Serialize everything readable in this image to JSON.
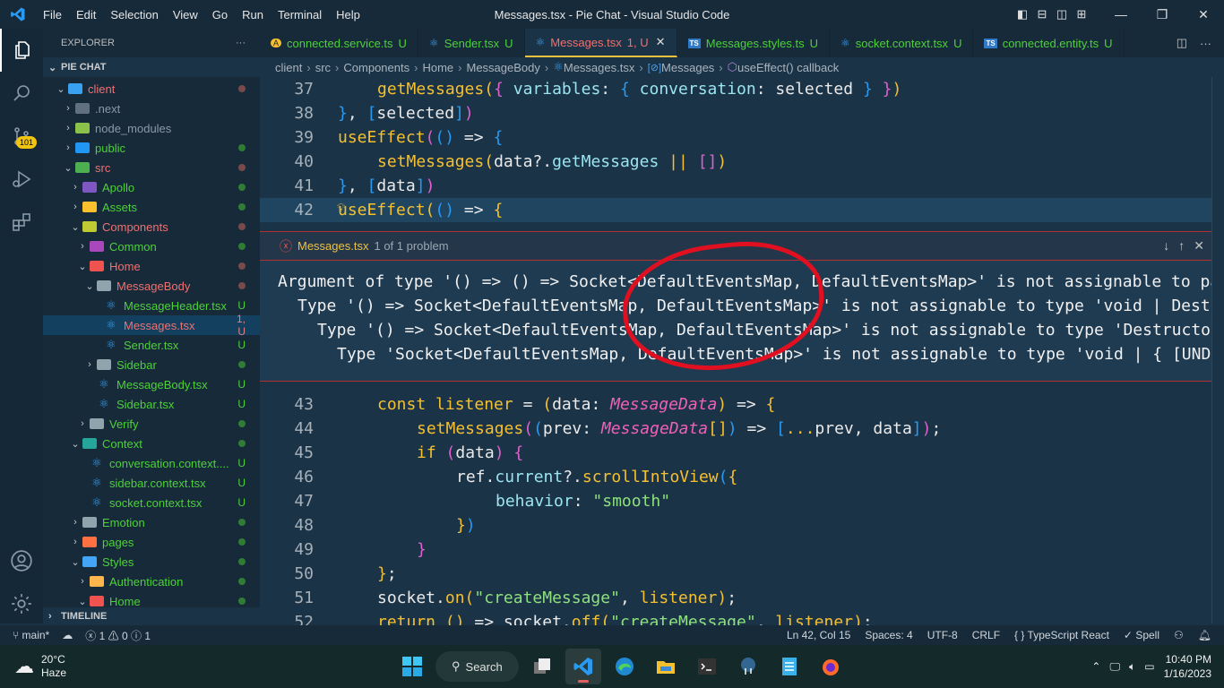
{
  "window": {
    "title": "Messages.tsx - Pie Chat - Visual Studio Code",
    "menu": [
      "File",
      "Edit",
      "Selection",
      "View",
      "Go",
      "Run",
      "Terminal",
      "Help"
    ]
  },
  "activity_bar": {
    "items": [
      "explorer",
      "search",
      "source-control",
      "run-debug",
      "extensions"
    ],
    "source_control_badge": "101",
    "bottom": [
      "accounts",
      "manage"
    ]
  },
  "sidebar": {
    "header": "EXPLORER",
    "more": "···",
    "section": "PIE CHAT",
    "tree": [
      {
        "label": "client",
        "depth": 1,
        "expanded": true,
        "kind": "folder",
        "color": "#f07070",
        "folder_color": "#3aa0f0",
        "status": "dot",
        "status_color": "#7a4a4a"
      },
      {
        "label": ".next",
        "depth": 2,
        "expanded": false,
        "kind": "folder",
        "color": "#8a9aa5",
        "folder_color": "#607080",
        "status": "",
        "status_color": ""
      },
      {
        "label": "node_modules",
        "depth": 2,
        "expanded": false,
        "kind": "folder",
        "color": "#8a9aa5",
        "folder_color": "#8bc34a",
        "status": "",
        "status_color": ""
      },
      {
        "label": "public",
        "depth": 2,
        "expanded": false,
        "kind": "folder",
        "color": "#4cd137",
        "folder_color": "#2196f3",
        "status": "dot",
        "status_color": "#2e7d32"
      },
      {
        "label": "src",
        "depth": 2,
        "expanded": true,
        "kind": "folder",
        "color": "#f07070",
        "folder_color": "#4caf50",
        "status": "dot",
        "status_color": "#7a4a4a"
      },
      {
        "label": "Apollo",
        "depth": 3,
        "expanded": false,
        "kind": "folder",
        "color": "#4cd137",
        "folder_color": "#7e57c2",
        "status": "dot",
        "status_color": "#2e7d32"
      },
      {
        "label": "Assets",
        "depth": 3,
        "expanded": false,
        "kind": "folder",
        "color": "#4cd137",
        "folder_color": "#fbc02d",
        "status": "dot",
        "status_color": "#2e7d32"
      },
      {
        "label": "Components",
        "depth": 3,
        "expanded": true,
        "kind": "folder",
        "color": "#f07070",
        "folder_color": "#c0ca33",
        "status": "dot",
        "status_color": "#7a4a4a"
      },
      {
        "label": "Common",
        "depth": 4,
        "expanded": false,
        "kind": "folder",
        "color": "#4cd137",
        "folder_color": "#ab47bc",
        "status": "dot",
        "status_color": "#2e7d32"
      },
      {
        "label": "Home",
        "depth": 4,
        "expanded": true,
        "kind": "folder",
        "color": "#f07070",
        "folder_color": "#ef5350",
        "status": "dot",
        "status_color": "#7a4a4a"
      },
      {
        "label": "MessageBody",
        "depth": 5,
        "expanded": true,
        "kind": "folder",
        "color": "#f07070",
        "folder_color": "#90a4ae",
        "status": "dot",
        "status_color": "#7a4a4a"
      },
      {
        "label": "MessageHeader.tsx",
        "depth": 6,
        "kind": "react",
        "color": "#4cd137",
        "status": "U",
        "status_color": "#4cd137"
      },
      {
        "label": "Messages.tsx",
        "depth": 6,
        "kind": "react",
        "color": "#f07070",
        "status": "1, U",
        "status_color": "#e08080",
        "selected": true
      },
      {
        "label": "Sender.tsx",
        "depth": 6,
        "kind": "react",
        "color": "#4cd137",
        "status": "U",
        "status_color": "#4cd137"
      },
      {
        "label": "Sidebar",
        "depth": 5,
        "expanded": false,
        "kind": "folder",
        "color": "#4cd137",
        "folder_color": "#90a4ae",
        "status": "dot",
        "status_color": "#2e7d32"
      },
      {
        "label": "MessageBody.tsx",
        "depth": 5,
        "kind": "react",
        "color": "#4cd137",
        "status": "U",
        "status_color": "#4cd137"
      },
      {
        "label": "Sidebar.tsx",
        "depth": 5,
        "kind": "react",
        "color": "#4cd137",
        "status": "U",
        "status_color": "#4cd137"
      },
      {
        "label": "Verify",
        "depth": 4,
        "expanded": false,
        "kind": "folder",
        "color": "#4cd137",
        "folder_color": "#90a4ae",
        "status": "dot",
        "status_color": "#2e7d32"
      },
      {
        "label": "Context",
        "depth": 3,
        "expanded": true,
        "kind": "folder",
        "color": "#4cd137",
        "folder_color": "#26a69a",
        "status": "dot",
        "status_color": "#2e7d32"
      },
      {
        "label": "conversation.context....",
        "depth": 4,
        "kind": "react",
        "color": "#4cd137",
        "status": "U",
        "status_color": "#4cd137"
      },
      {
        "label": "sidebar.context.tsx",
        "depth": 4,
        "kind": "react",
        "color": "#4cd137",
        "status": "U",
        "status_color": "#4cd137"
      },
      {
        "label": "socket.context.tsx",
        "depth": 4,
        "kind": "react",
        "color": "#4cd137",
        "status": "U",
        "status_color": "#4cd137"
      },
      {
        "label": "Emotion",
        "depth": 3,
        "expanded": false,
        "kind": "folder",
        "color": "#4cd137",
        "folder_color": "#90a4ae",
        "status": "dot",
        "status_color": "#2e7d32"
      },
      {
        "label": "pages",
        "depth": 3,
        "expanded": false,
        "kind": "folder",
        "color": "#4cd137",
        "folder_color": "#ff7043",
        "status": "dot",
        "status_color": "#2e7d32"
      },
      {
        "label": "Styles",
        "depth": 3,
        "expanded": true,
        "kind": "folder",
        "color": "#4cd137",
        "folder_color": "#42a5f5",
        "status": "dot",
        "status_color": "#2e7d32"
      },
      {
        "label": "Authentication",
        "depth": 4,
        "expanded": false,
        "kind": "folder",
        "color": "#4cd137",
        "folder_color": "#ffb74d",
        "status": "dot",
        "status_color": "#2e7d32"
      },
      {
        "label": "Home",
        "depth": 4,
        "expanded": true,
        "kind": "folder",
        "color": "#4cd137",
        "folder_color": "#ef5350",
        "status": "dot",
        "status_color": "#2e7d32"
      }
    ],
    "timeline": "TIMELINE"
  },
  "tabs": [
    {
      "label": "connected.service.ts",
      "status": "U",
      "icon": "angular-icon",
      "icon_glyph": "A",
      "icon_color": "#f5c030",
      "color": "#4cd137",
      "active": false
    },
    {
      "label": "Sender.tsx",
      "status": "U",
      "icon": "react-icon",
      "icon_glyph": "⚛",
      "icon_color": "#3aa0f0",
      "color": "#4cd137",
      "active": false
    },
    {
      "label": "Messages.tsx",
      "status": "1, U",
      "icon": "react-icon",
      "icon_glyph": "⚛",
      "icon_color": "#3aa0f0",
      "color": "#f07070",
      "active": true,
      "close": "✕"
    },
    {
      "label": "Messages.styles.ts",
      "status": "U",
      "icon": "typescript-icon",
      "icon_glyph": "TS",
      "icon_color": "#3178c6",
      "color": "#4cd137",
      "active": false
    },
    {
      "label": "socket.context.tsx",
      "status": "U",
      "icon": "react-icon",
      "icon_glyph": "⚛",
      "icon_color": "#3aa0f0",
      "color": "#4cd137",
      "active": false
    },
    {
      "label": "connected.entity.ts",
      "status": "U",
      "icon": "typescript-icon",
      "icon_glyph": "TS",
      "icon_color": "#3178c6",
      "color": "#4cd137",
      "active": false
    }
  ],
  "breadcrumb": [
    "client",
    "src",
    "Components",
    "Home",
    "MessageBody",
    "Messages.tsx",
    "Messages",
    "useEffect() callback"
  ],
  "editor": {
    "lines_before": [
      {
        "n": "37",
        "indent": 2,
        "tokens": [
          [
            "fn",
            "getMessages"
          ],
          [
            "b1",
            "("
          ],
          [
            "b2",
            "{"
          ],
          [
            "plain",
            " "
          ],
          [
            "prop",
            "variables"
          ],
          [
            "plain",
            ": "
          ],
          [
            "b3",
            "{"
          ],
          [
            "plain",
            " "
          ],
          [
            "prop",
            "conversation"
          ],
          [
            "plain",
            ": selected "
          ],
          [
            "b3",
            "}"
          ],
          [
            "plain",
            " "
          ],
          [
            "b2",
            "}"
          ],
          [
            "b1",
            ")"
          ]
        ]
      },
      {
        "n": "38",
        "indent": 1,
        "tokens": [
          [
            "b3",
            "}"
          ],
          [
            "plain",
            ", "
          ],
          [
            "b3",
            "["
          ],
          [
            "plain",
            "selected"
          ],
          [
            "b3",
            "]"
          ],
          [
            "b2",
            ")"
          ]
        ]
      },
      {
        "n": "39",
        "indent": 1,
        "tokens": [
          [
            "fn",
            "useEffect"
          ],
          [
            "b2",
            "("
          ],
          [
            "b3",
            "()"
          ],
          [
            "plain",
            " => "
          ],
          [
            "b3",
            "{"
          ]
        ]
      },
      {
        "n": "40",
        "indent": 2,
        "tokens": [
          [
            "fn",
            "setMessages"
          ],
          [
            "b1",
            "("
          ],
          [
            "plain",
            "data?."
          ],
          [
            "prop",
            "getMessages"
          ],
          [
            "plain",
            " "
          ],
          [
            "b1",
            "||"
          ],
          [
            "plain",
            " "
          ],
          [
            "b2",
            "[]"
          ],
          [
            "b1",
            ")"
          ]
        ]
      },
      {
        "n": "41",
        "indent": 1,
        "tokens": [
          [
            "b3",
            "}"
          ],
          [
            "plain",
            ", "
          ],
          [
            "b3",
            "["
          ],
          [
            "plain",
            "data"
          ],
          [
            "b3",
            "]"
          ],
          [
            "b2",
            ")"
          ]
        ]
      },
      {
        "n": "42",
        "indent": 1,
        "current": true,
        "tokens": [
          [
            "fn",
            "useEffect"
          ],
          [
            "b1",
            "("
          ],
          [
            "b3",
            "()"
          ],
          [
            "plain",
            " => "
          ],
          [
            "b1",
            "{"
          ]
        ]
      }
    ],
    "peek": {
      "file": "Messages.tsx",
      "count": "1 of 1 problem",
      "messages": [
        "Argument of type '() => () => Socket<DefaultEventsMap, DefaultEventsMap>' is not assignable to parameter of type 'EffectCallback'.",
        "  Type '() => Socket<DefaultEventsMap, DefaultEventsMap>' is not assignable to type 'void | Destructor'.",
        "    Type '() => Socket<DefaultEventsMap, DefaultEventsMap>' is not assignable to type 'Destructor'.",
        "      Type 'Socket<DefaultEventsMap, DefaultEventsMap>' is not assignable to type 'void | { [UNDEFINED_VOID_ONLY]: never; }'."
      ]
    },
    "lines_after": [
      {
        "n": "43",
        "indent": 2,
        "tokens": [
          [
            "kw",
            "const "
          ],
          [
            "fn",
            "listener"
          ],
          [
            "plain",
            " = "
          ],
          [
            "b1",
            "("
          ],
          [
            "plain",
            "data: "
          ],
          [
            "type",
            "MessageData"
          ],
          [
            "b1",
            ")"
          ],
          [
            "plain",
            " => "
          ],
          [
            "b1",
            "{"
          ]
        ]
      },
      {
        "n": "44",
        "indent": 3,
        "tokens": [
          [
            "fn",
            "setMessages"
          ],
          [
            "b2",
            "("
          ],
          [
            "b3",
            "("
          ],
          [
            "plain",
            "prev: "
          ],
          [
            "type",
            "MessageData"
          ],
          [
            "b1",
            "[]"
          ],
          [
            "b3",
            ")"
          ],
          [
            "plain",
            " => "
          ],
          [
            "b3",
            "["
          ],
          [
            "b1",
            "..."
          ],
          [
            "plain",
            "prev, data"
          ],
          [
            "b3",
            "]"
          ],
          [
            "b2",
            ")"
          ],
          [
            "plain",
            ";"
          ]
        ]
      },
      {
        "n": "45",
        "indent": 3,
        "tokens": [
          [
            "kw",
            "if "
          ],
          [
            "b2",
            "("
          ],
          [
            "plain",
            "data"
          ],
          [
            "b2",
            ")"
          ],
          [
            "plain",
            " "
          ],
          [
            "b2",
            "{"
          ]
        ]
      },
      {
        "n": "46",
        "indent": 4,
        "tokens": [
          [
            "plain",
            "ref."
          ],
          [
            "prop",
            "current"
          ],
          [
            "plain",
            "?."
          ],
          [
            "fn",
            "scrollIntoView"
          ],
          [
            "b3",
            "("
          ],
          [
            "b1",
            "{"
          ]
        ]
      },
      {
        "n": "47",
        "indent": 5,
        "tokens": [
          [
            "prop",
            "behavior"
          ],
          [
            "plain",
            ": "
          ],
          [
            "str",
            "\"smooth\""
          ]
        ]
      },
      {
        "n": "48",
        "indent": 4,
        "tokens": [
          [
            "b1",
            "}"
          ],
          [
            "b3",
            ")"
          ]
        ]
      },
      {
        "n": "49",
        "indent": 3,
        "tokens": [
          [
            "b2",
            "}"
          ]
        ]
      },
      {
        "n": "50",
        "indent": 2,
        "tokens": [
          [
            "b1",
            "}"
          ],
          [
            "plain",
            ";"
          ]
        ]
      },
      {
        "n": "51",
        "indent": 2,
        "tokens": [
          [
            "plain",
            "socket."
          ],
          [
            "fn",
            "on"
          ],
          [
            "b1",
            "("
          ],
          [
            "str",
            "\"createMessage\""
          ],
          [
            "plain",
            ", "
          ],
          [
            "kw",
            "listener"
          ],
          [
            "b1",
            ")"
          ],
          [
            "plain",
            ";"
          ]
        ]
      },
      {
        "n": "52",
        "indent": 2,
        "tokens": [
          [
            "kw",
            "return "
          ],
          [
            "b1",
            "()"
          ],
          [
            "plain",
            " => socket."
          ],
          [
            "fn",
            "off"
          ],
          [
            "b1",
            "("
          ],
          [
            "str",
            "\"createMessage\""
          ],
          [
            "plain",
            ", "
          ],
          [
            "kw",
            "listener"
          ],
          [
            "b1",
            ")"
          ],
          [
            "plain",
            ";"
          ]
        ]
      }
    ]
  },
  "statusbar": {
    "branch": "main*",
    "errors": "1",
    "warnings": "0",
    "infos": "1",
    "position": "Ln 42, Col 15",
    "spaces": "Spaces: 4",
    "encoding": "UTF-8",
    "eol": "CRLF",
    "language": "TypeScript React",
    "spell": "Spell"
  },
  "taskbar": {
    "temperature": "20°C",
    "weather": "Haze",
    "search": "Search",
    "time": "10:40 PM",
    "date": "1/16/2023",
    "apps": [
      "task-view",
      "vscode",
      "edge",
      "file-explorer",
      "terminal",
      "postgresql",
      "notepad",
      "firefox"
    ]
  }
}
